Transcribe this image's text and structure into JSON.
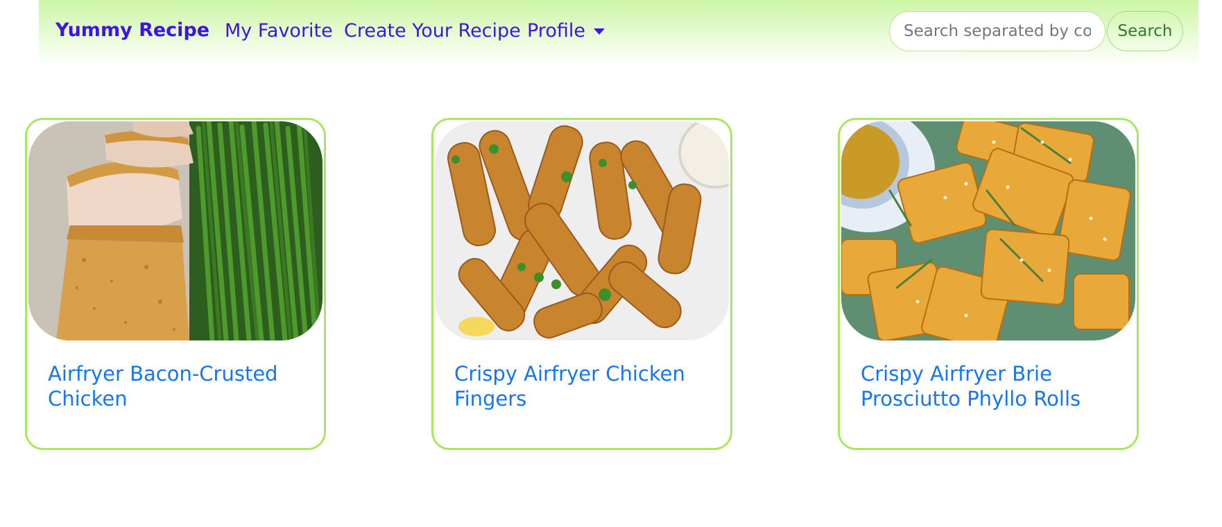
{
  "navbar": {
    "brand": "Yummy Recipe",
    "links": [
      {
        "label": "My Favorite"
      },
      {
        "label": "Create Your Recipe"
      },
      {
        "label": "Profile"
      }
    ],
    "search": {
      "placeholder": "Search separated by comma",
      "value": "",
      "button_label": "Search"
    },
    "colors": {
      "brand": "#3d14e6",
      "navbar_bg": "#ccf5a6",
      "search_button_text": "#2f7a2a"
    }
  },
  "recipes": [
    {
      "title": "Airfryer Bacon-Crusted Chicken",
      "image": "breaded-chicken-breast-with-green-beans-photo"
    },
    {
      "title": "Crispy Airfryer Chicken Fingers",
      "image": "crispy-chicken-fingers-photo"
    },
    {
      "title": "Crispy Airfryer Brie Prosciutto Phyllo Rolls",
      "image": "phyllo-rolls-with-sesame-photo"
    }
  ],
  "colors": {
    "card_border": "#a9e85e",
    "card_title": "#1676f2"
  }
}
